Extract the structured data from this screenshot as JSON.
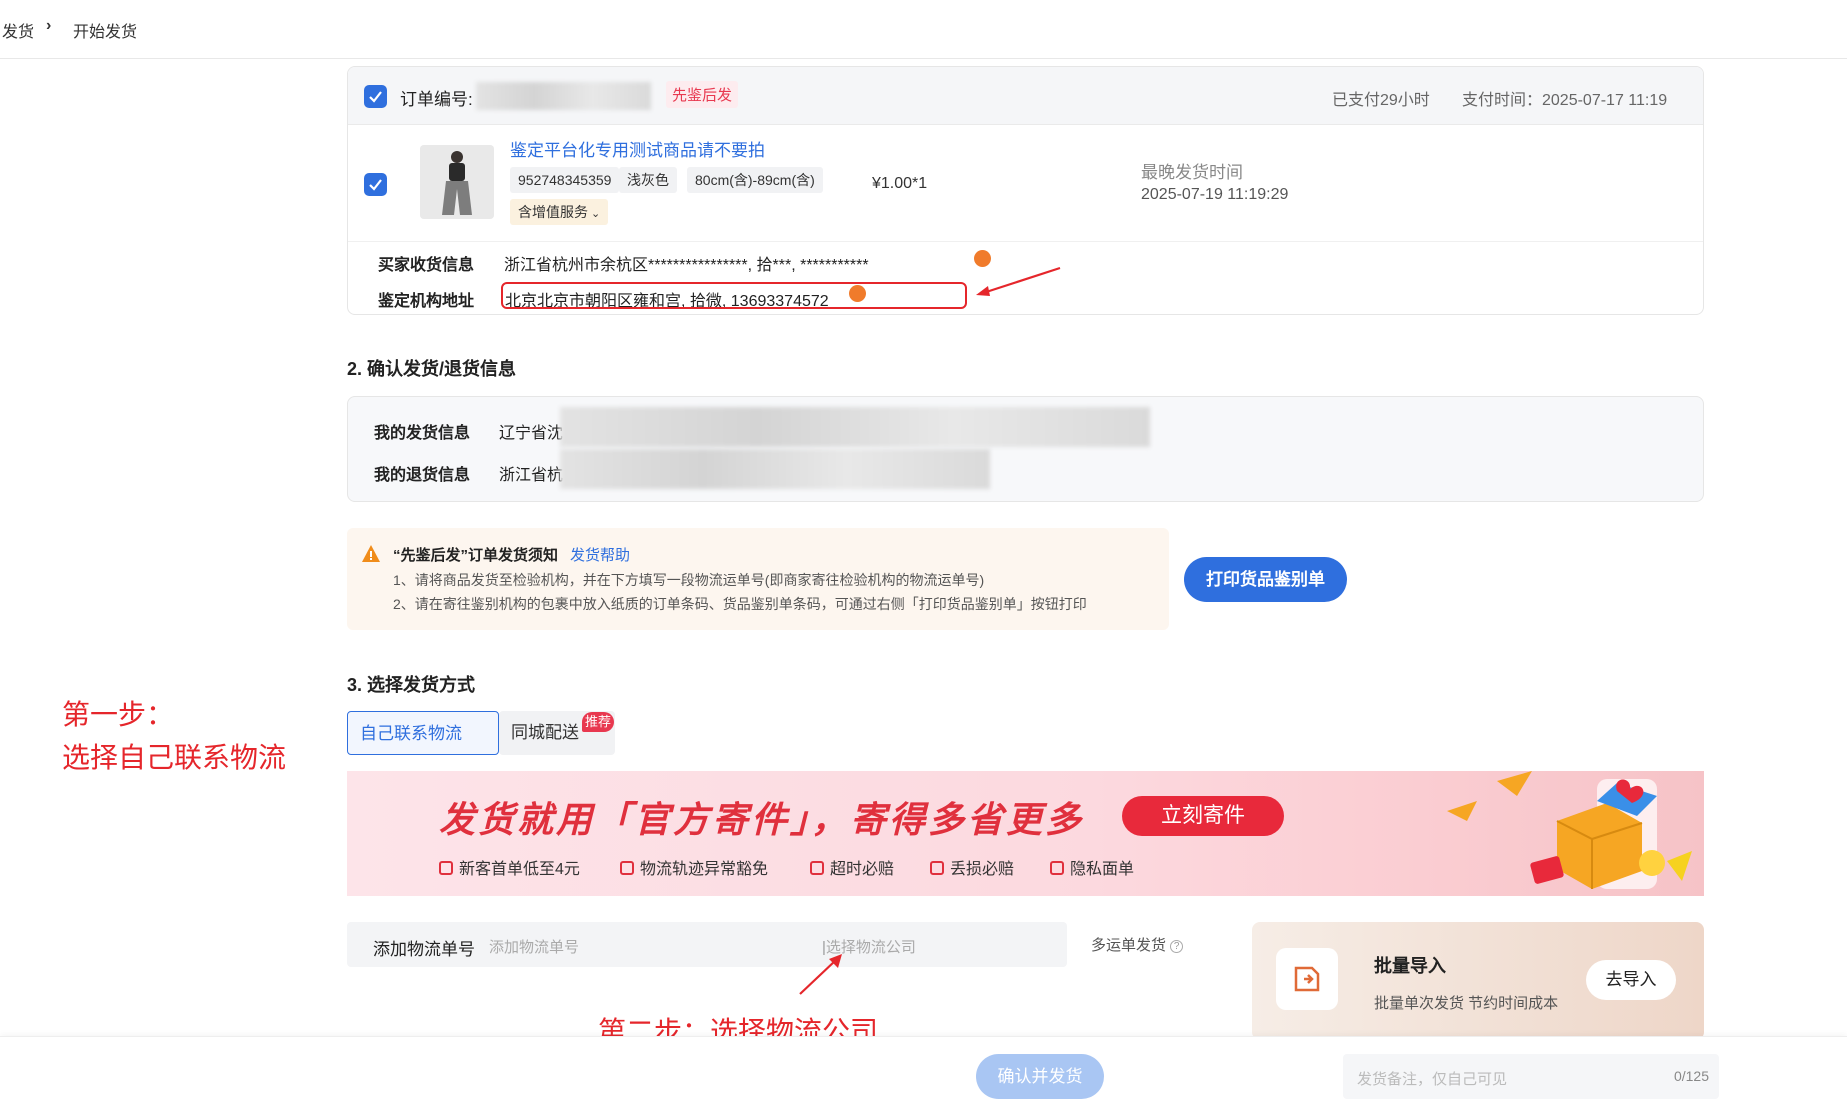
{
  "breadcrumb": {
    "parent": "发货",
    "current": "开始发货"
  },
  "order": {
    "number_label": "订单编号:",
    "tag": "先鉴后发",
    "paid_ago": "已支付29小时",
    "pay_time": "支付时间：2025-07-17 11:19",
    "product_title": "鉴定平台化专用测试商品请不要拍",
    "sku_id": "952748345359",
    "color": "浅灰色",
    "size": "80cm(含)-89cm(含)",
    "value_added": "含增值服务",
    "price_qty": "¥1.00*1",
    "latest_ship_label": "最晚发货时间",
    "latest_ship_time": "2025-07-19 11:19:29",
    "buyer_label": "买家收货信息",
    "buyer_address": "浙江省杭州市余杭区****************, 拾***, ***********",
    "auth_label": "鉴定机构地址",
    "auth_address": "北京北京市朝阳区雍和宫, 拾微, 13693374572"
  },
  "section2": {
    "title": "2. 确认发货/退货信息",
    "ship_label": "我的发货信息",
    "ship_value": "辽宁省沈",
    "return_label": "我的退货信息",
    "return_value": "浙江省杭"
  },
  "notice": {
    "title": "“先鉴后发”订单发货须知",
    "help_link": "发货帮助",
    "line1": "1、请将商品发货至检验机构，并在下方填写一段物流运单号(即商家寄往检验机构的物流运单号)",
    "line2": "2、请在寄往鉴别机构的包裹中放入纸质的订单条码、货品鉴别单条码，可通过右侧「打印货品鉴别单」按钮打印",
    "print_button": "打印货品鉴别单"
  },
  "section3": {
    "title": "3. 选择发货方式",
    "tab_self": "自己联系物流",
    "tab_city": "同城配送",
    "tab_badge": "推荐"
  },
  "banner": {
    "title": "发货就用「官方寄件」，寄得多省更多",
    "button": "立刻寄件",
    "perks": [
      "新客首单低至4元",
      "物流轨迹异常豁免",
      "超时必赔",
      "丢损必赔",
      "隐私面单"
    ]
  },
  "tracking": {
    "label": "添加物流单号",
    "input_placeholder": "添加物流单号",
    "company_placeholder": "选择物流公司",
    "multi_label": "多运单发货"
  },
  "batch": {
    "title": "批量导入",
    "subtitle": "批量单次发货  节约时间成本",
    "button": "去导入"
  },
  "annotations": {
    "step1_line1": "第一步：",
    "step1_line2": "选择自己联系物流",
    "step2": "第二步：选择物流公司"
  },
  "footer": {
    "confirm": "确认并发货",
    "remark_placeholder": "发货备注，仅自己可见",
    "remark_count": "0/125"
  },
  "colors": {
    "primary": "#2f6fde",
    "annotation_red": "#e5262b",
    "tag_pink": "#e8384f"
  }
}
